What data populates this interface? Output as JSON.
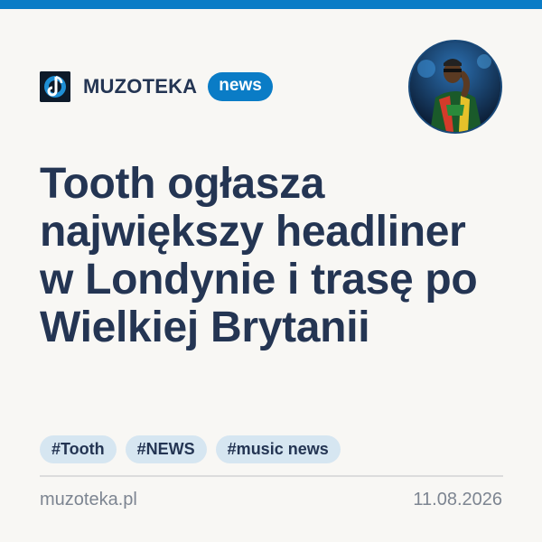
{
  "brand": {
    "name": "MUZOTEKA",
    "badge": "news",
    "logo_icon": "music-note-icon"
  },
  "avatar": {
    "icon": "artist-photo"
  },
  "headline": "Tooth ogłasza największy headliner w Londynie i trasę po Wielkiej Brytanii",
  "tags": [
    "#Tooth",
    "#NEWS",
    "#music news"
  ],
  "footer": {
    "site": "muzoteka.pl",
    "date": "11.08.2026"
  },
  "colors": {
    "accent": "#0a7cc6",
    "text": "#243553",
    "tag_bg": "#d6e6f1",
    "muted": "#7d8591",
    "background": "#f8f7f4"
  }
}
